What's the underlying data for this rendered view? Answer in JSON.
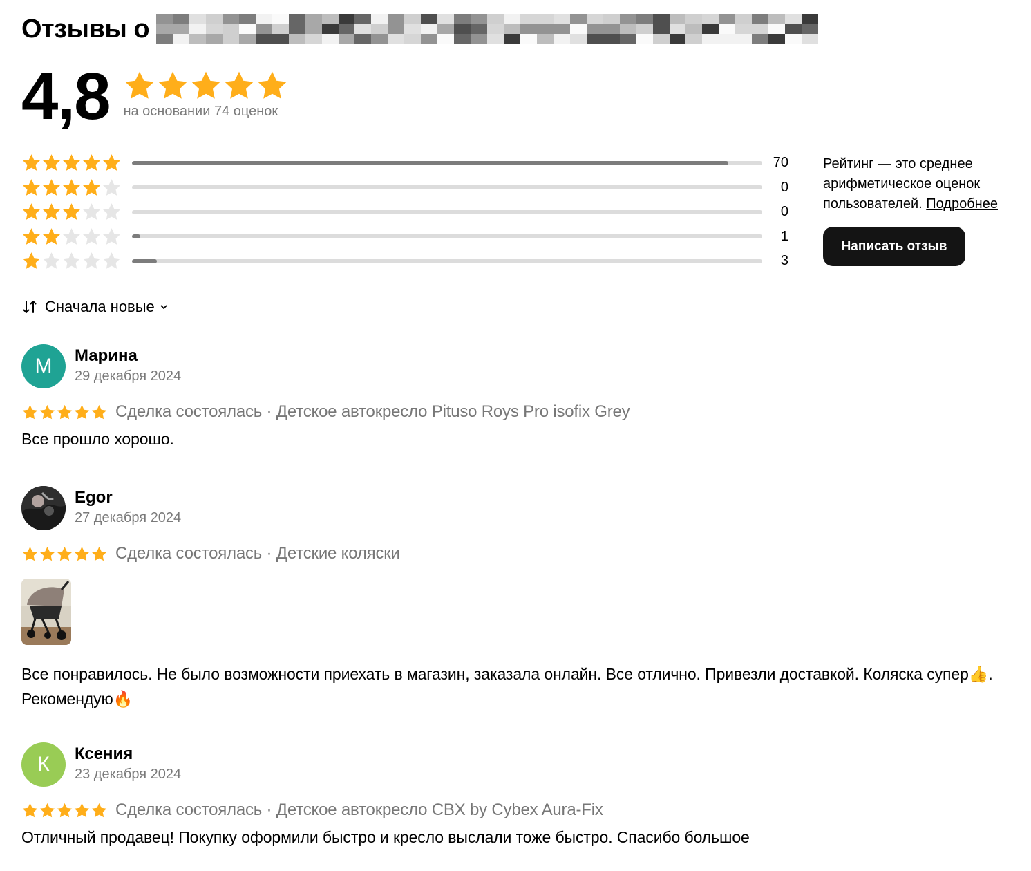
{
  "header": {
    "title": "Отзывы о",
    "title_masked": true
  },
  "summary": {
    "rating": "4,8",
    "stars": 5,
    "basis": "на основании 74 оценок"
  },
  "distribution": [
    {
      "stars": 5,
      "count": "70",
      "fraction": 0.946
    },
    {
      "stars": 4,
      "count": "0",
      "fraction": 0
    },
    {
      "stars": 3,
      "count": "0",
      "fraction": 0
    },
    {
      "stars": 2,
      "count": "1",
      "fraction": 0.0135
    },
    {
      "stars": 1,
      "count": "3",
      "fraction": 0.04
    }
  ],
  "note": {
    "text": "Рейтинг — это среднее арифметическое оценок пользователей. ",
    "link": "Подробнее"
  },
  "write_button": "Написать отзыв",
  "sort": {
    "label": "Сначала новые"
  },
  "colors": {
    "star_filled": "#FFAE1A",
    "star_empty": "#E6E6E6",
    "bar_fill": "#7C7C7C",
    "bar_track": "#DCDCDC",
    "button_bg": "#141414"
  },
  "reviews": [
    {
      "avatar_letter": "М",
      "avatar_color": "#1FA394",
      "name": "Марина",
      "date": "29 декабря 2024",
      "stars": 5,
      "deal": "Сделка состоялась · Детское автокресло Pituso Roys Pro isofix Grey",
      "text": "Все прошло хорошо."
    },
    {
      "avatar_letter": "",
      "avatar_color": "#3a3a3a",
      "name": "Egor",
      "date": "27 декабря 2024",
      "stars": 5,
      "deal": "Сделка состоялась · Детские коляски",
      "text": "Все понравилось. Не было возможности приехать в магазин, заказала онлайн. Все отлично. Привезли доставкой. Коляска супер👍. Рекомендую🔥"
    },
    {
      "avatar_letter": "К",
      "avatar_color": "#99CC55",
      "name": "Ксения",
      "date": "23 декабря 2024",
      "stars": 5,
      "deal": "Сделка состоялась · Детское автокресло CBX by Cybex Aura-Fix",
      "text": "Отличный продавец! Покупку оформили быстро и кресло выслали тоже быстро. Спасибо большое"
    }
  ]
}
